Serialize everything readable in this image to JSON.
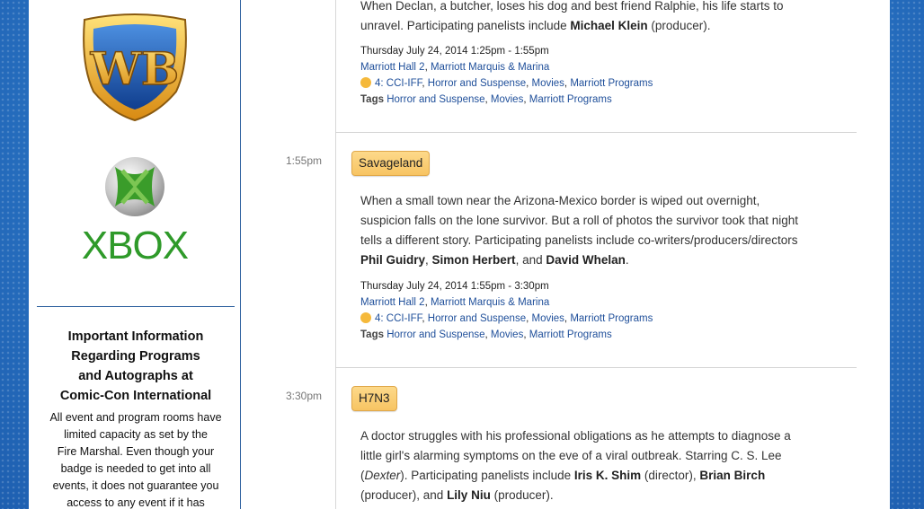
{
  "sidebar": {
    "wb_logo_text": "WB",
    "xbox_logo_text": "XBOX",
    "info_title_lines": [
      "Important Information",
      "Regarding Programs",
      "and Autographs at",
      "Comic-Con International"
    ],
    "info_body_lines": [
      "All event and program rooms have",
      "limited capacity as set by the",
      "Fire Marshal. Even though your",
      "badge is needed to get into all",
      "events, it does not guarantee you",
      "access to any event if it has"
    ]
  },
  "events": [
    {
      "time": "",
      "title": "",
      "desc": [
        {
          "t": "When Declan, a butcher, loses his dog and best friend Ralphie, his life starts to"
        },
        {
          "t": "unravel. Participating panelists include "
        },
        {
          "b": "Michael Klein"
        },
        {
          "t": " (producer)."
        }
      ],
      "datetime": "Thursday July 24, 2014 1:25pm - 1:55pm",
      "location": [
        "Marriott Hall 2",
        "Marriott Marquis & Marina"
      ],
      "track": "4: CCI-IFF",
      "categories": [
        "Horror and Suspense",
        "Movies",
        "Marriott Programs"
      ],
      "tags_label": "Tags",
      "tags": [
        "Horror and Suspense",
        "Movies",
        "Marriott Programs"
      ]
    },
    {
      "time": "1:55pm",
      "title": "Savageland",
      "desc_lines": [
        [
          {
            "t": "When a small town near the Arizona-Mexico border is wiped out overnight,"
          }
        ],
        [
          {
            "t": "suspicion falls on the lone survivor. But a roll of photos the survivor took that night"
          }
        ],
        [
          {
            "t": "tells a different story. Participating panelists include co-writers/producers/directors"
          }
        ],
        [
          {
            "b": "Phil Guidry"
          },
          {
            "t": ", "
          },
          {
            "b": "Simon Herbert"
          },
          {
            "t": ", and "
          },
          {
            "b": "David Whelan"
          },
          {
            "t": "."
          }
        ]
      ],
      "datetime": "Thursday July 24, 2014 1:55pm - 3:30pm",
      "location": [
        "Marriott Hall 2",
        "Marriott Marquis & Marina"
      ],
      "track": "4: CCI-IFF",
      "categories": [
        "Horror and Suspense",
        "Movies",
        "Marriott Programs"
      ],
      "tags_label": "Tags",
      "tags": [
        "Horror and Suspense",
        "Movies",
        "Marriott Programs"
      ]
    },
    {
      "time": "3:30pm",
      "title": "H7N3",
      "desc_lines": [
        [
          {
            "t": "A doctor struggles with his professional obligations as he attempts to diagnose a"
          }
        ],
        [
          {
            "t": "little girl's alarming symptoms on the eve of a viral outbreak. Starring C. S. Lee"
          }
        ],
        [
          {
            "t": "("
          },
          {
            "i": "Dexter"
          },
          {
            "t": "). Participating panelists include "
          },
          {
            "b": "Iris K. Shim"
          },
          {
            "t": " (director), "
          },
          {
            "b": "Brian Birch"
          }
        ],
        [
          {
            "t": "(producer), and "
          },
          {
            "b": "Lily Niu"
          },
          {
            "t": " (producer)."
          }
        ]
      ]
    }
  ],
  "colors": {
    "accent_button": "#f7c463",
    "link": "#1f4f9a",
    "track_dot": "#f5b93b",
    "frame": "#2b5f9e"
  }
}
